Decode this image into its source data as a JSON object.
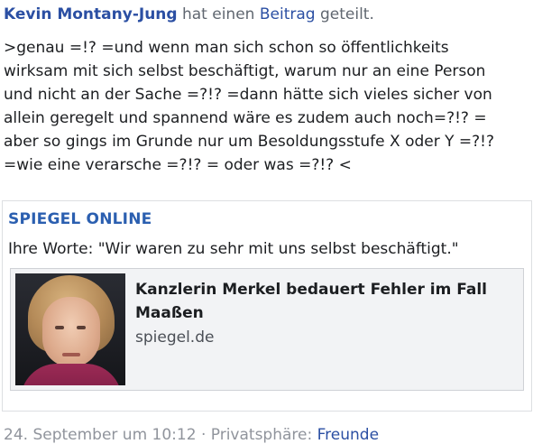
{
  "header": {
    "author": "Kevin Montany-Jung",
    "text_before_link": "hat einen",
    "post_link": "Beitrag",
    "text_after_link": "geteilt."
  },
  "body": {
    "lines": [
      ">genau =!? =und wenn man sich schon so öffentlichkeits",
      "wirksam mit sich selbst beschäftigt, warum nur an eine Person",
      "und nicht an der Sache =?!? =dann hätte sich vieles sicher von",
      "allein geregelt und spannend wäre es zudem auch noch=?!? =",
      "aber so gings im Grunde nur um Besoldungsstufe X oder Y =?!?",
      "=wie eine verarsche =?!? = oder was =?!? <"
    ]
  },
  "shared": {
    "source": "SPIEGEL ONLINE",
    "quote": "Ihre Worte: \"Wir waren zu sehr mit uns selbst beschäftigt.\"",
    "preview": {
      "title": "Kanzlerin Merkel bedauert Fehler im Fall Maaßen",
      "domain": "spiegel.de"
    }
  },
  "footer": {
    "timestamp": "24. September um 10:12",
    "separator": "·",
    "privacy_label": "Privatsphäre:",
    "privacy_value": "Freunde"
  }
}
